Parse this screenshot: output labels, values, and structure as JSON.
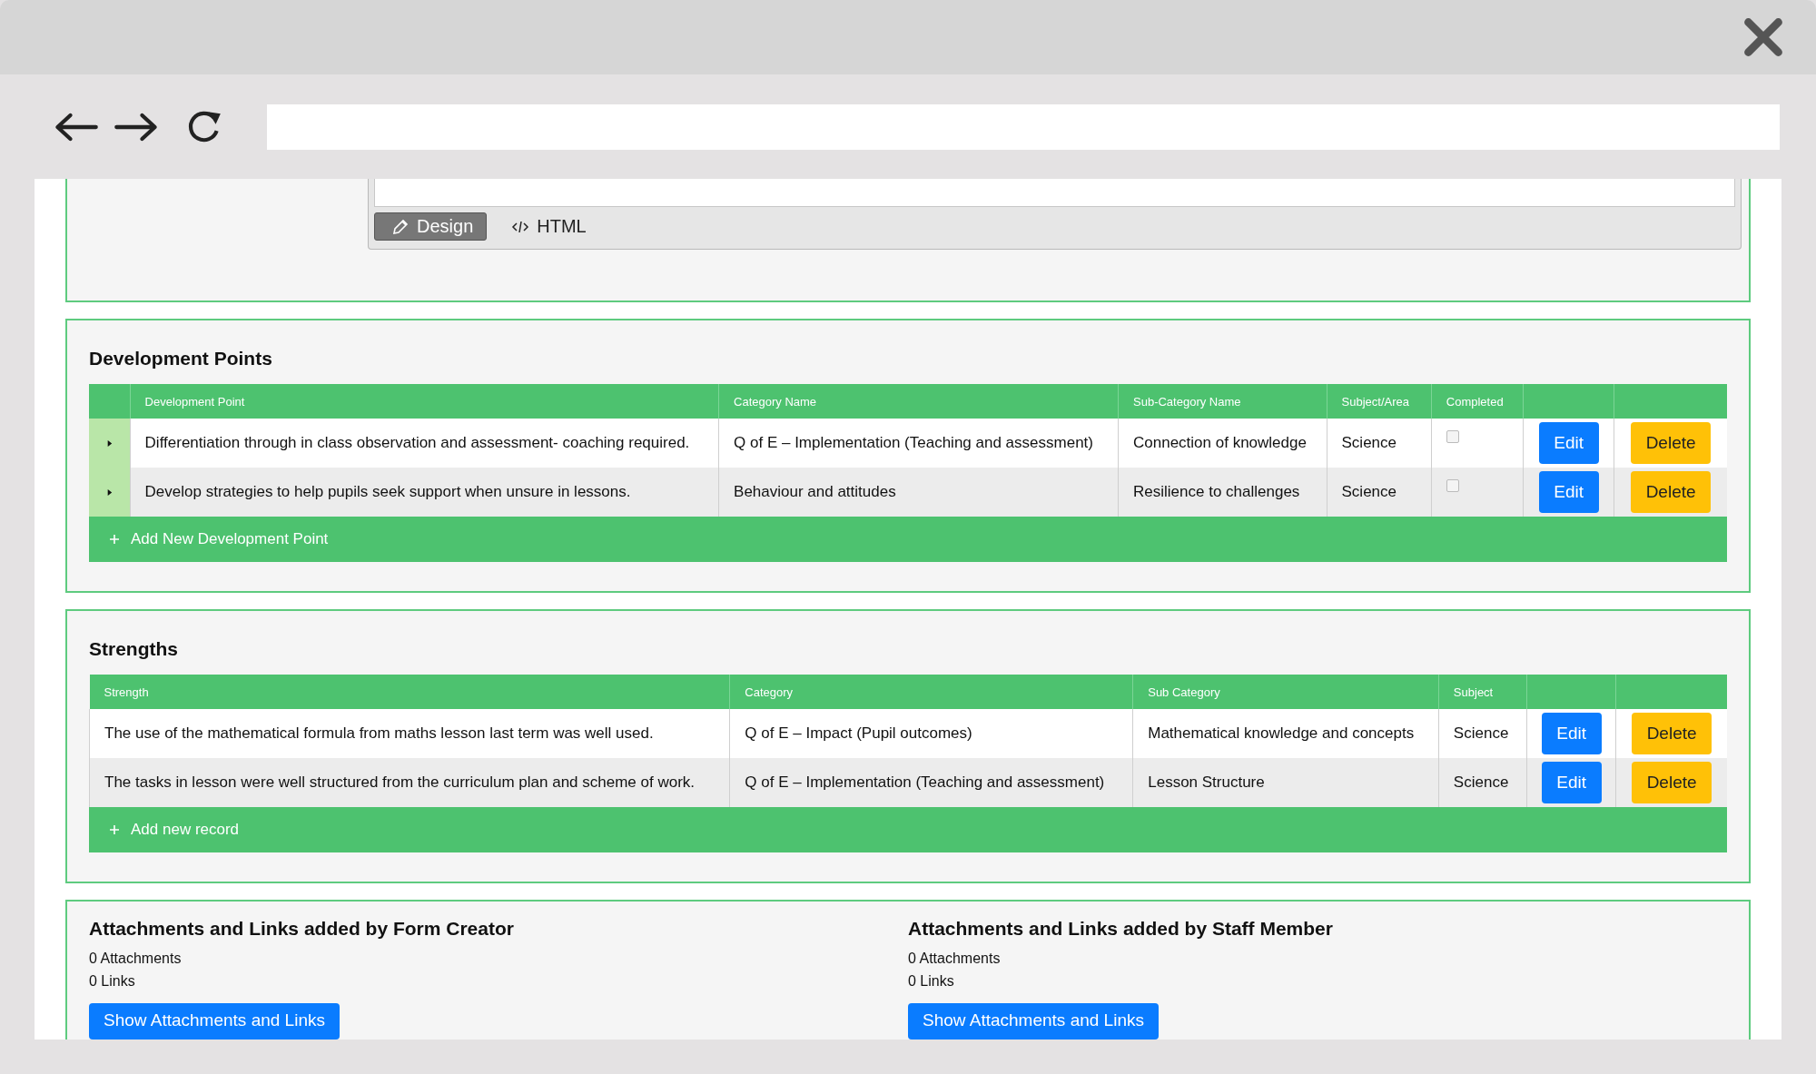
{
  "editor": {
    "modes": [
      {
        "label": "Design",
        "selected": true
      },
      {
        "label": "HTML",
        "selected": false
      }
    ]
  },
  "tables": [
    {
      "title": "Development Points",
      "columns": [
        "Development Point",
        "Category Name",
        "Sub-Category Name",
        "Subject/Area",
        "Completed"
      ],
      "rows": [
        {
          "expanded": false,
          "cells": [
            "Differentiation through in class observation and assessment- coaching required.",
            "Q of E – Implementation (Teaching and assessment)",
            "Connection of knowledge",
            "Science"
          ],
          "completed": false,
          "edit": "Edit",
          "delete": "Delete"
        },
        {
          "expanded": false,
          "cells": [
            "Develop strategies to help pupils seek support when unsure in lessons.",
            "Behaviour and attitudes",
            "Resilience to challenges",
            "Science"
          ],
          "completed": false,
          "edit": "Edit",
          "delete": "Delete"
        }
      ],
      "add_label": "Add New Development Point"
    },
    {
      "title": "Strengths",
      "columns": [
        "Strength",
        "Category",
        "Sub Category",
        "Subject"
      ],
      "rows": [
        {
          "cells": [
            "The use of the mathematical formula from maths lesson last term was well used.",
            "Q of E – Impact (Pupil outcomes)",
            "Mathematical knowledge and concepts",
            "Science"
          ],
          "edit": "Edit",
          "delete": "Delete"
        },
        {
          "cells": [
            "The tasks in lesson were well structured from the curriculum plan and scheme of work.",
            "Q of E – Implementation (Teaching and assessment)",
            "Lesson Structure",
            "Science"
          ],
          "edit": "Edit",
          "delete": "Delete"
        }
      ],
      "add_label": "Add new record"
    }
  ],
  "attachments": [
    {
      "title": "Attachments and Links added by Form Creator",
      "attachments": "0 Attachments",
      "links": "0 Links",
      "button": "Show Attachments and Links"
    },
    {
      "title": "Attachments and Links added by Staff Member",
      "attachments": "0 Attachments",
      "links": "0 Links",
      "button": "Show Attachments and Links"
    }
  ]
}
